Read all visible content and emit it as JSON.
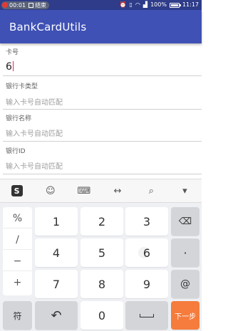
{
  "status_bar": {
    "time_recording": "00:01",
    "end_label": "结束",
    "battery": "100%",
    "battery_level": 1.0,
    "clock": "11:17"
  },
  "app_bar": {
    "title": "BankCardUtils"
  },
  "form": {
    "card_no": {
      "label": "卡号",
      "value": "6"
    },
    "card_type": {
      "label": "银行卡类型",
      "placeholder": "输入卡号自动匹配"
    },
    "bank_name": {
      "label": "银行名称",
      "placeholder": "输入卡号自动匹配"
    },
    "bank_id": {
      "label": "银行ID",
      "placeholder": "输入卡号自动匹配"
    }
  },
  "keyboard": {
    "toolbar_icons": [
      "sogou-logo-icon",
      "emoji-icon",
      "keyboard-icon",
      "cursor-move-icon",
      "search-icon",
      "collapse-icon"
    ],
    "symbols": [
      "%",
      "/",
      "−",
      "+"
    ],
    "digits": {
      "k1": "1",
      "k2": "2",
      "k3": "3",
      "k4": "4",
      "k5": "5",
      "k6": "6",
      "k7": "7",
      "k8": "8",
      "k9": "9",
      "k0": "0"
    },
    "dot": "·",
    "at": "@",
    "symbol_switch": "符",
    "next": "下一步"
  },
  "colors": {
    "status_bar": "#2e3c8a",
    "app_bar": "#3f51b5",
    "caret": "#e91e63",
    "next_key": "#f57c3c"
  }
}
